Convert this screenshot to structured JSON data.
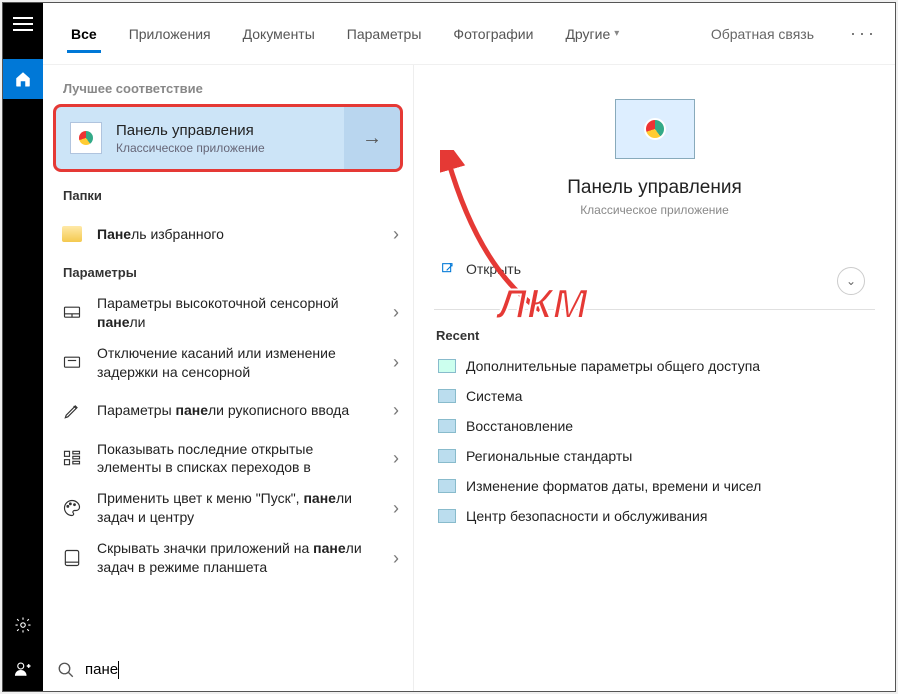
{
  "tabs": {
    "all": "Все",
    "apps": "Приложения",
    "docs": "Документы",
    "settings": "Параметры",
    "photos": "Фотографии",
    "more": "Другие",
    "feedback": "Обратная связь"
  },
  "sections": {
    "best": "Лучшее соответствие",
    "folders": "Папки",
    "settings": "Параметры"
  },
  "bestMatch": {
    "title": "Панель управления",
    "subtitle": "Классическое приложение"
  },
  "folder_item_prefix": "Пане",
  "folder_item_suffix": "ль избранного",
  "settings_items": [
    {
      "pre": "Параметры высокоточной сенсорной ",
      "bold": "пане",
      "post": "ли"
    },
    {
      "pre": "Отключение касаний или изменение задержки на сенсорной",
      "bold": "",
      "post": ""
    },
    {
      "pre": "Параметры ",
      "bold": "пане",
      "post": "ли рукописного ввода"
    },
    {
      "pre": "Показывать последние открытые элементы в списках переходов в",
      "bold": "",
      "post": ""
    },
    {
      "pre": "Применить цвет к меню \"Пуск\", ",
      "bold": "пане",
      "post": "ли задач и центру"
    },
    {
      "pre": "Скрывать значки приложений на ",
      "bold": "пане",
      "post": "ли задач в режиме планшета"
    }
  ],
  "details": {
    "title": "Панель управления",
    "subtitle": "Классическое приложение",
    "open": "Открыть",
    "recent_h": "Recent",
    "recent": [
      "Дополнительные параметры общего доступа",
      "Система",
      "Восстановление",
      "Региональные стандарты",
      "Изменение форматов даты, времени и чисел",
      "Центр безопасности и обслуживания"
    ]
  },
  "search_value": "пане",
  "annotation": "ЛКМ"
}
